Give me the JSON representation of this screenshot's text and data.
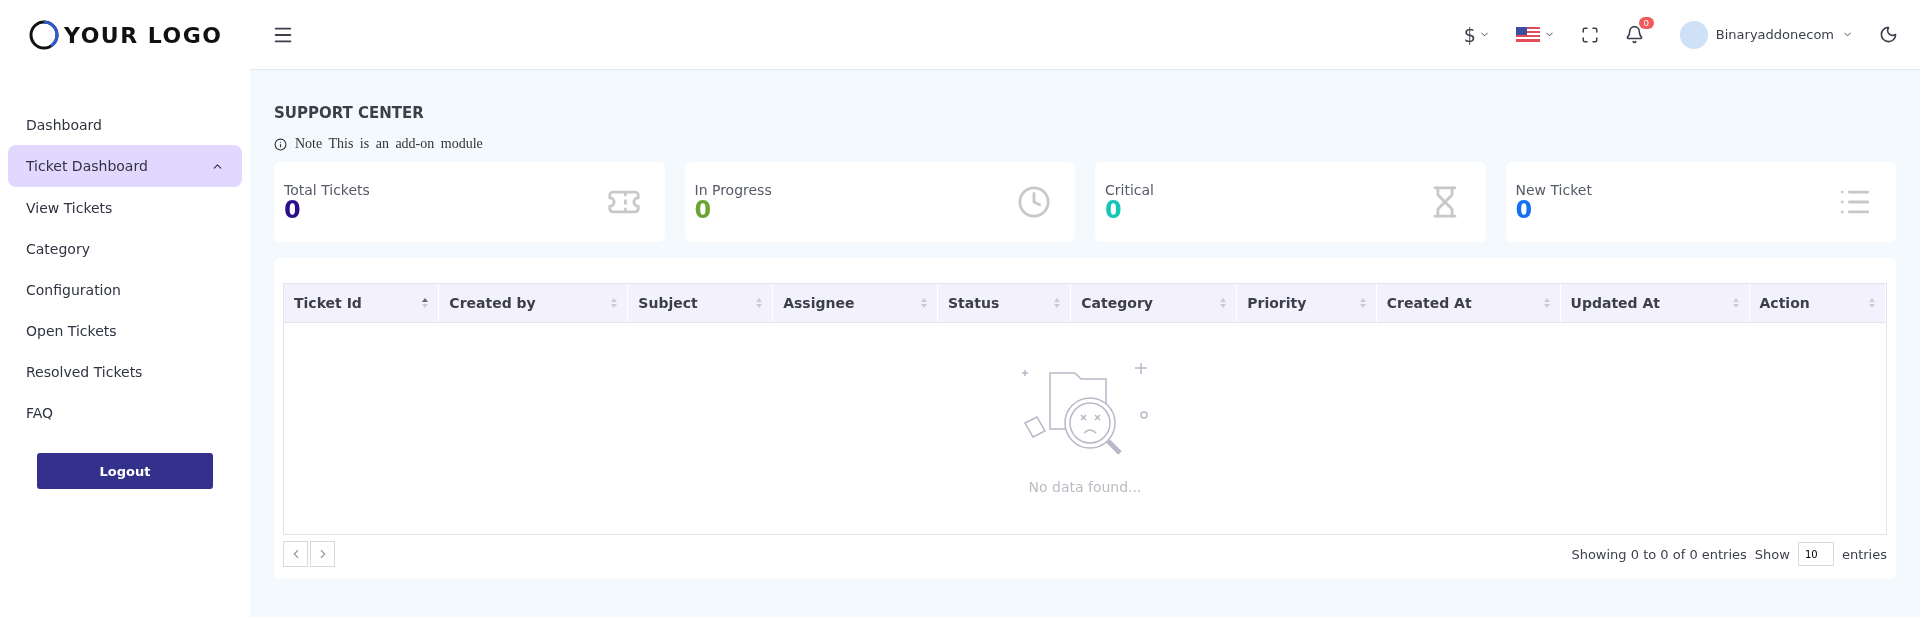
{
  "logo": {
    "text": "YOUR LOGO"
  },
  "header": {
    "currency": "$",
    "notifications": "0",
    "user": "Binaryaddonecom"
  },
  "sidebar": {
    "items": [
      {
        "label": "Dashboard",
        "selected": false,
        "expanded": false
      },
      {
        "label": "Ticket Dashboard",
        "selected": true,
        "expanded": true
      },
      {
        "label": "View Tickets",
        "selected": false,
        "expanded": false
      },
      {
        "label": "Category",
        "selected": false,
        "expanded": false
      },
      {
        "label": "Configuration",
        "selected": false,
        "expanded": false
      },
      {
        "label": "Open Tickets",
        "selected": false,
        "expanded": false
      },
      {
        "label": "Resolved Tickets",
        "selected": false,
        "expanded": false
      },
      {
        "label": "FAQ",
        "selected": false,
        "expanded": false
      }
    ],
    "logout": "Logout"
  },
  "page": {
    "title": "SUPPORT CENTER",
    "note": "Note This is an add-on module"
  },
  "stats": [
    {
      "label": "Total Tickets",
      "value": "0",
      "color": "#2a0f8a",
      "kind": "ticket"
    },
    {
      "label": "In Progress",
      "value": "0",
      "color": "#6aa531",
      "kind": "clock"
    },
    {
      "label": "Critical",
      "value": "0",
      "color": "#14c6b4",
      "kind": "hourglass"
    },
    {
      "label": "New Ticket",
      "value": "0",
      "color": "#1570ef",
      "kind": "list"
    }
  ],
  "table": {
    "columns": [
      {
        "label": "Ticket Id",
        "sorted": true
      },
      {
        "label": "Created by",
        "sorted": false
      },
      {
        "label": "Subject",
        "sorted": false
      },
      {
        "label": "Assignee",
        "sorted": false
      },
      {
        "label": "Status",
        "sorted": false
      },
      {
        "label": "Category",
        "sorted": false
      },
      {
        "label": "Priority",
        "sorted": false
      },
      {
        "label": "Created At",
        "sorted": false
      },
      {
        "label": "Updated At",
        "sorted": false
      },
      {
        "label": "Action",
        "sorted": false
      }
    ],
    "empty": "No data found...",
    "info": "Showing 0 to 0 of 0 entries",
    "show_label": "Show",
    "page_size": "10",
    "entries_label": "entries"
  }
}
